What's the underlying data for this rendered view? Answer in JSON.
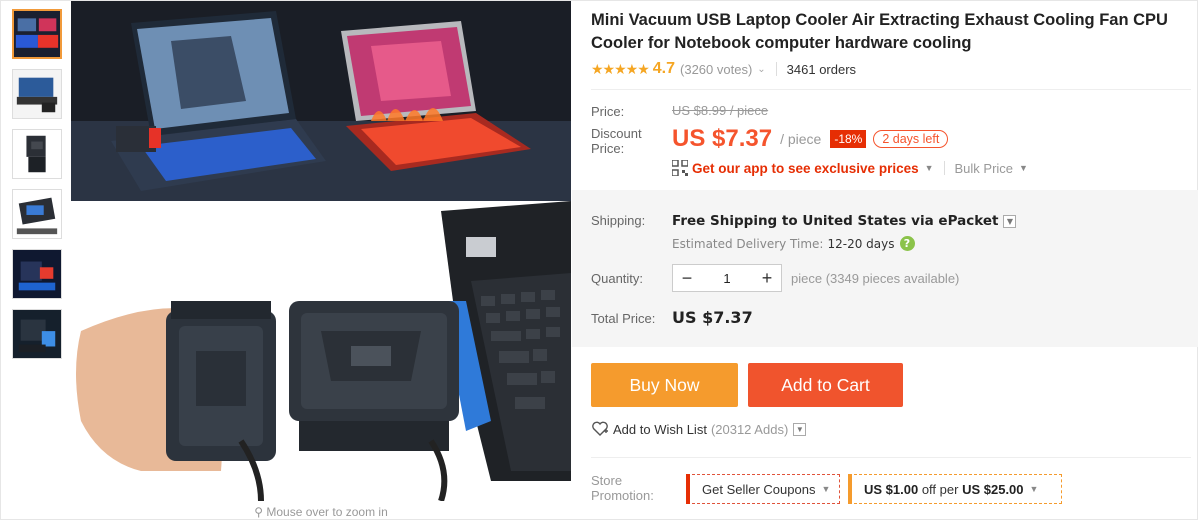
{
  "product": {
    "title": "Mini Vacuum USB Laptop Cooler Air Extracting Exhaust Cooling Fan CPU Cooler for Notebook computer hardware cooling",
    "stars": "★★★★★",
    "rating": "4.7",
    "votes": "(3260 votes)",
    "orders": "3461 orders"
  },
  "gallery": {
    "thumbnails": [
      "thumb-1",
      "thumb-2",
      "thumb-3",
      "thumb-4",
      "thumb-5",
      "thumb-6"
    ],
    "zoom_hint": "Mouse over to zoom in"
  },
  "pricing": {
    "price_label": "Price:",
    "original_price": "US $8.99 / piece",
    "discount_label_1": "Discount",
    "discount_label_2": "Price:",
    "discount_price": "US $7.37",
    "per_unit": "/ piece",
    "discount_percent": "-18%",
    "days_left": "2 days left",
    "app_promo": "Get our app to see exclusive prices",
    "bulk_price": "Bulk Price"
  },
  "shipping": {
    "label": "Shipping:",
    "text_1": "Free Shipping to",
    "destination": "United States",
    "text_2": "via ePacket",
    "estimate_label": "Estimated Delivery Time:",
    "estimate_value": "12-20 days"
  },
  "quantity": {
    "label": "Quantity:",
    "minus": "−",
    "value": "1",
    "plus": "+",
    "available": "piece (3349 pieces available)"
  },
  "total": {
    "label": "Total Price:",
    "value": "US $7.37"
  },
  "actions": {
    "buy_now": "Buy Now",
    "add_to_cart": "Add to Cart",
    "wishlist": "Add to Wish List",
    "wishlist_count": "(20312 Adds)"
  },
  "promotion": {
    "label_1": "Store",
    "label_2": "Promotion:",
    "coupon_text": "Get Seller Coupons",
    "deal_amount": "US $1.00",
    "deal_mid": "off per",
    "deal_min": "US $25.00"
  },
  "colors": {
    "accent_orange": "#f59b2d",
    "accent_red": "#f0542d",
    "price_red": "#f5542d",
    "star": "#f5a623"
  }
}
